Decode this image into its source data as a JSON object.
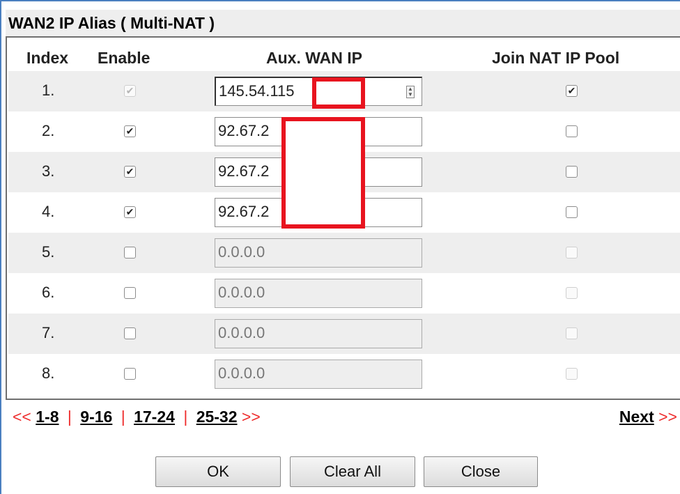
{
  "title": "WAN2 IP Alias ( Multi-NAT )",
  "headers": {
    "index": "Index",
    "enable": "Enable",
    "aux_wan_ip": "Aux. WAN IP",
    "join_nat": "Join NAT IP Pool"
  },
  "rows": [
    {
      "index": "1.",
      "enable": true,
      "enable_disabled": true,
      "ip": "145.54.115",
      "ip_disabled": false,
      "join_nat": true,
      "join_disabled": false
    },
    {
      "index": "2.",
      "enable": true,
      "enable_disabled": false,
      "ip": "92.67.2",
      "ip_disabled": false,
      "join_nat": false,
      "join_disabled": false
    },
    {
      "index": "3.",
      "enable": true,
      "enable_disabled": false,
      "ip": "92.67.2",
      "ip_disabled": false,
      "join_nat": false,
      "join_disabled": false
    },
    {
      "index": "4.",
      "enable": true,
      "enable_disabled": false,
      "ip": "92.67.2",
      "ip_disabled": false,
      "join_nat": false,
      "join_disabled": false
    },
    {
      "index": "5.",
      "enable": false,
      "enable_disabled": false,
      "ip": "0.0.0.0",
      "ip_disabled": true,
      "join_nat": false,
      "join_disabled": true
    },
    {
      "index": "6.",
      "enable": false,
      "enable_disabled": false,
      "ip": "0.0.0.0",
      "ip_disabled": true,
      "join_nat": false,
      "join_disabled": true
    },
    {
      "index": "7.",
      "enable": false,
      "enable_disabled": false,
      "ip": "0.0.0.0",
      "ip_disabled": true,
      "join_nat": false,
      "join_disabled": true
    },
    {
      "index": "8.",
      "enable": false,
      "enable_disabled": false,
      "ip": "0.0.0.0",
      "ip_disabled": true,
      "join_nat": false,
      "join_disabled": true
    }
  ],
  "pager": {
    "prev_arrow": "<<",
    "pages": [
      "1-8",
      "9-16",
      "17-24",
      "25-32"
    ],
    "separator": "|",
    "next_arrow": ">>",
    "next_label": "Next"
  },
  "buttons": {
    "ok": "OK",
    "clear_all": "Clear All",
    "close": "Close"
  },
  "colors": {
    "redaction": "#e8141f",
    "pager_arrow": "#ee2d2d",
    "alt_row": "#eeeeee"
  }
}
